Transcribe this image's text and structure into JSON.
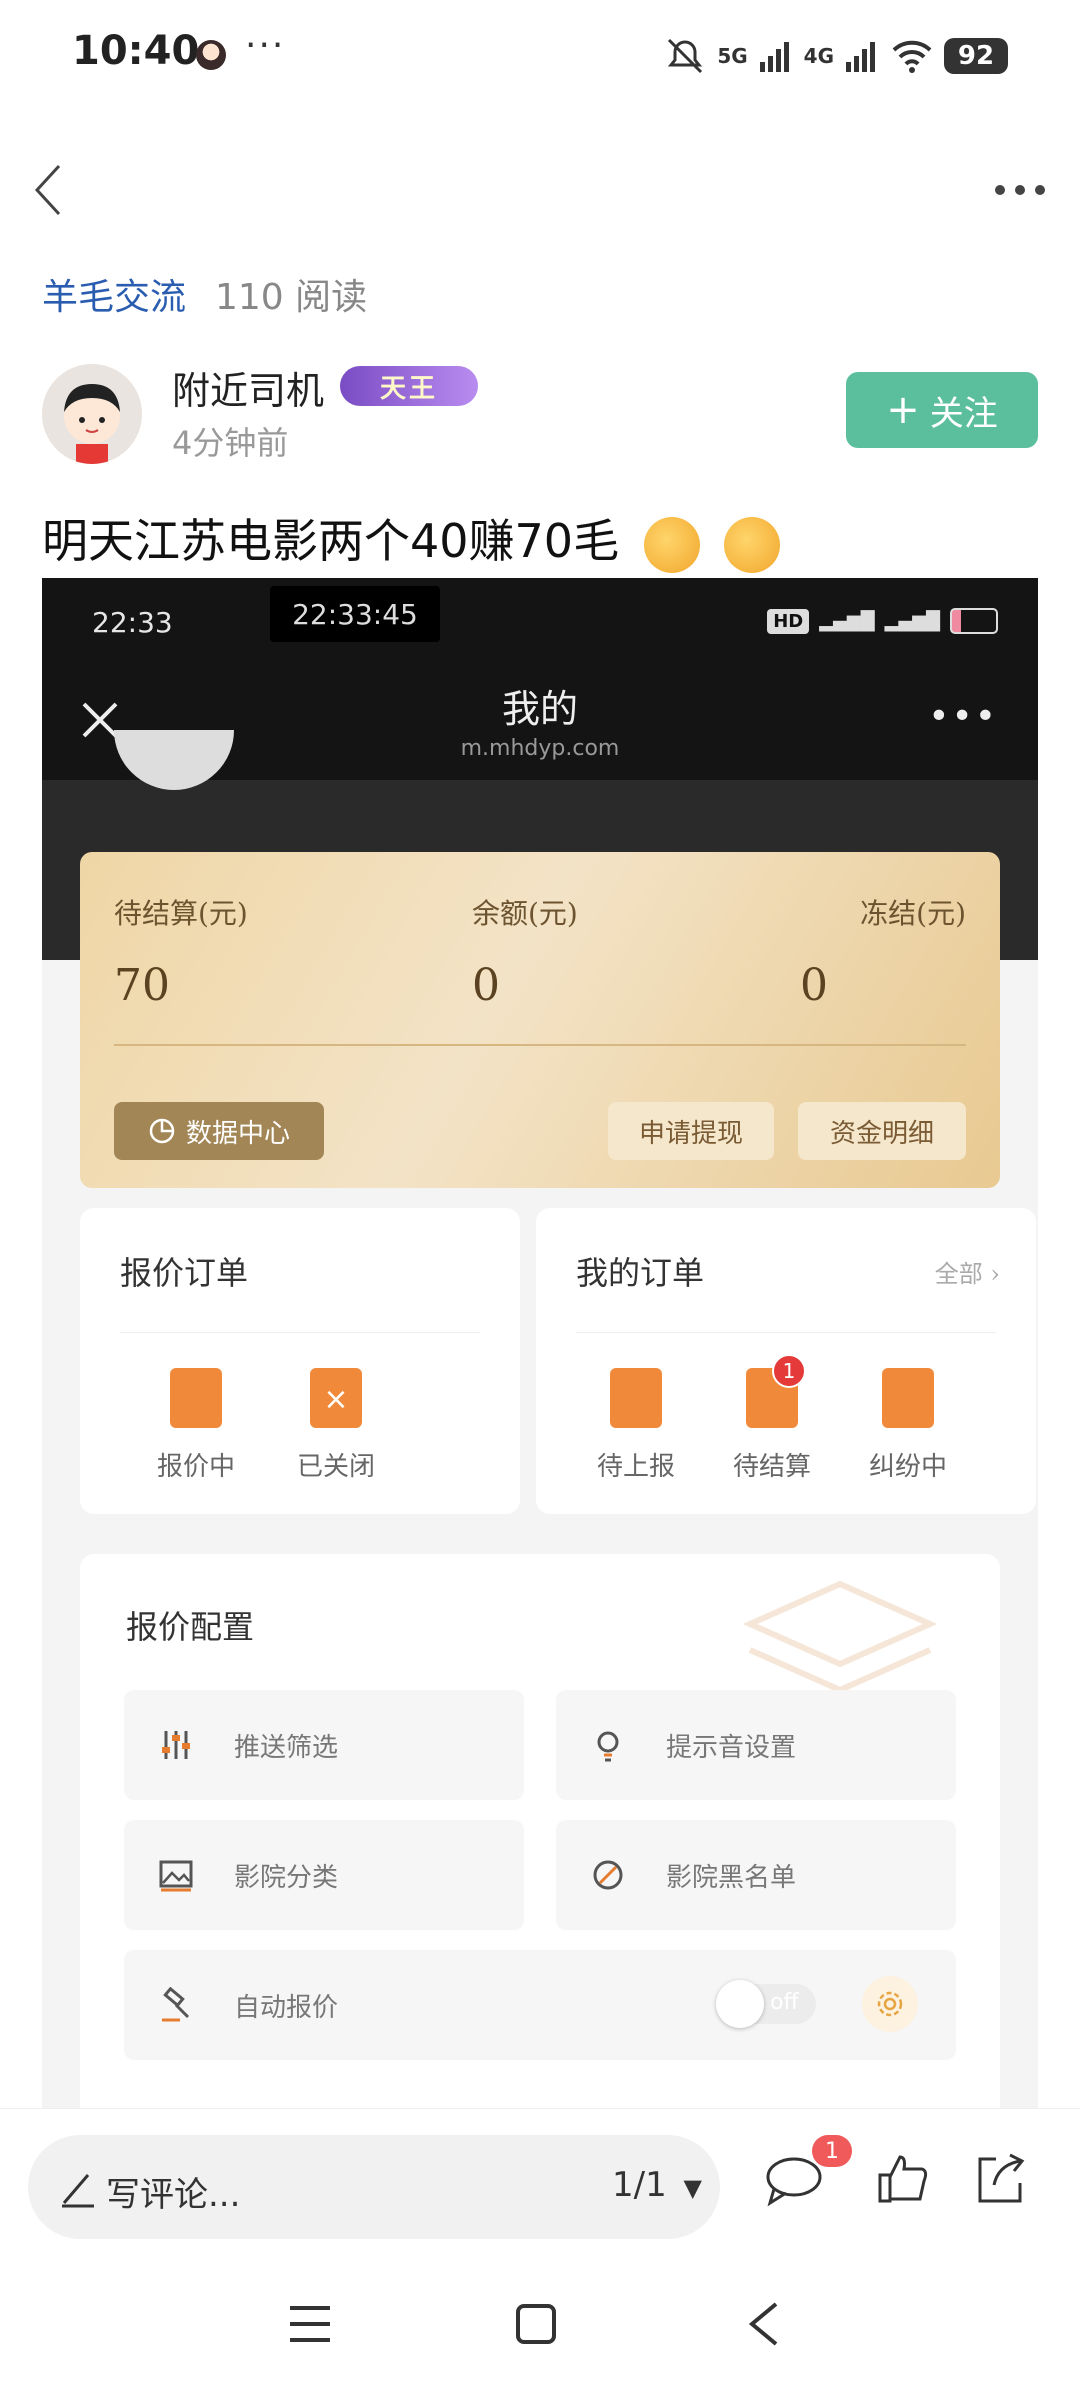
{
  "status_bar": {
    "time": "10:40",
    "dots": "···",
    "net1": "5G",
    "net2": "4G",
    "battery": "92"
  },
  "nav": {
    "back_icon": "chevron-left-icon",
    "more_icon": "more-horizontal-icon"
  },
  "post": {
    "tag": "羊毛交流",
    "views": "110 阅读",
    "author": "附近司机",
    "badge": "天王",
    "time": "4分钟前",
    "follow_label": "关注",
    "title": "明天江苏电影两个40赚70毛"
  },
  "shot": {
    "status_time": "22:33",
    "clock": "22:33:45",
    "title": "我的",
    "url": "m.mhdyp.com",
    "wallet": {
      "pending_label": "待结算(元)",
      "pending_value": "70",
      "balance_label": "余额(元)",
      "balance_value": "0",
      "frozen_label": "冻结(元)",
      "frozen_value": "0",
      "data_center": "数据中心",
      "withdraw": "申请提现",
      "details": "资金明细"
    },
    "quote_orders": {
      "title": "报价订单",
      "items": [
        "报价中",
        "已关闭"
      ]
    },
    "my_orders": {
      "title": "我的订单",
      "all": "全部",
      "items": [
        "待上报",
        "待结算",
        "纠纷中"
      ],
      "badge": "1"
    },
    "quote_config": {
      "title": "报价配置",
      "tiles": [
        "推送筛选",
        "提示音设置",
        "影院分类",
        "影院黑名单",
        "自动报价"
      ],
      "toggle": "off"
    }
  },
  "bottom": {
    "comment_placeholder": "写评论...",
    "page": "1/1",
    "comment_badge": "1"
  },
  "colors": {
    "accent": "#5bbf9e",
    "link": "#2a5db0",
    "gold": "#efd6a6",
    "orange": "#f08a3a"
  }
}
